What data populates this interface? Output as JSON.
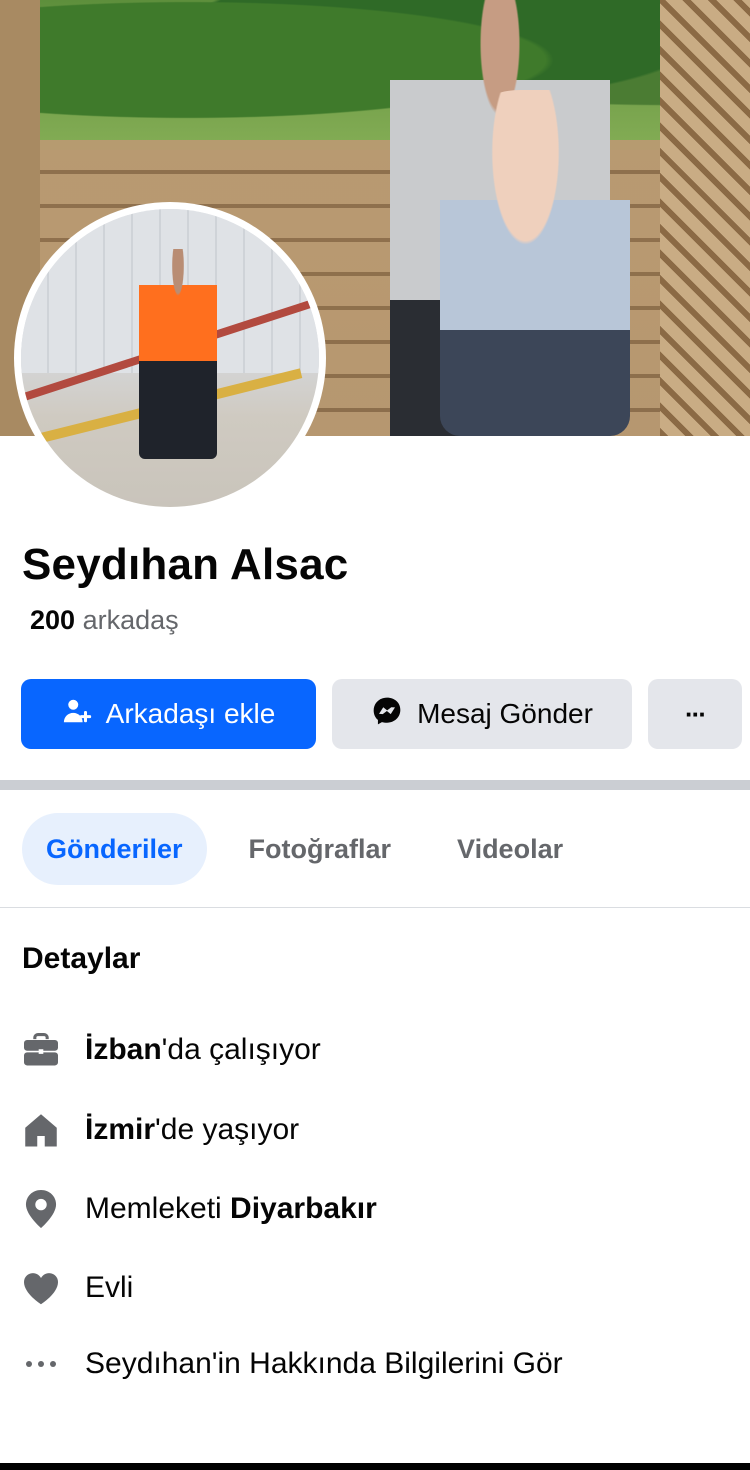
{
  "profile": {
    "name": "Seydıhan Alsac",
    "friends_count": "200",
    "friends_label": "arkadaş"
  },
  "actions": {
    "add_friend": "Arkadaşı ekle",
    "send_message": "Mesaj Gönder",
    "more": "···"
  },
  "tabs": [
    {
      "label": "Gönderiler",
      "active": true
    },
    {
      "label": "Fotoğraflar",
      "active": false
    },
    {
      "label": "Videolar",
      "active": false
    }
  ],
  "details": {
    "title": "Detaylar",
    "work": {
      "bold": "İzban",
      "rest": "'da çalışıyor",
      "icon": "briefcase-icon"
    },
    "lives": {
      "bold": "İzmir",
      "rest": "'de yaşıyor",
      "icon": "home-icon"
    },
    "hometown": {
      "prefix": "Memleketi ",
      "bold": "Diyarbakır",
      "icon": "location-pin-icon"
    },
    "relationship": {
      "text": "Evli",
      "icon": "heart-icon"
    },
    "see_about": {
      "text": "Seydıhan'in Hakkında Bilgilerini Gör",
      "icon": "more-dots-icon"
    }
  },
  "colors": {
    "primary": "#0866ff",
    "secondary_button": "#e4e6eb",
    "muted_text": "#65676b",
    "active_tab_bg": "#e7f0fd"
  }
}
